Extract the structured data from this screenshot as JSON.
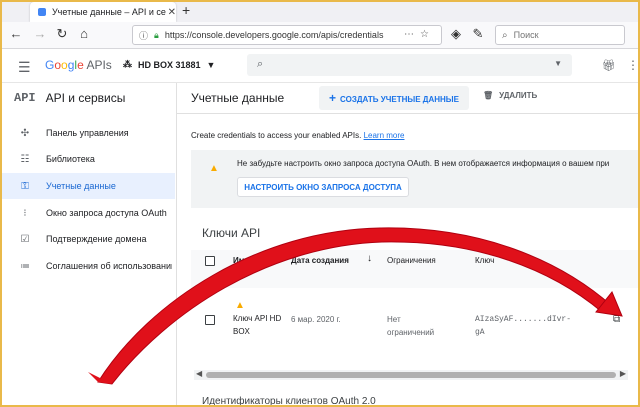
{
  "browser": {
    "tab_title": "Учетные данные – API и сервисы",
    "tab_close": "✕",
    "new_tab": "+",
    "url": "https://console.developers.google.com/apis/credentials",
    "search_placeholder": "Поиск"
  },
  "header": {
    "logo_google": [
      "G",
      "o",
      "o",
      "g",
      "l",
      "e"
    ],
    "logo_apis": "APIs",
    "project": "HD BOX 31881"
  },
  "sidebar": {
    "icon_text": "API",
    "title": "API и сервисы",
    "items": [
      {
        "label": "Панель управления",
        "icon": "dashboard-icon",
        "active": false
      },
      {
        "label": "Библиотека",
        "icon": "library-icon",
        "active": false
      },
      {
        "label": "Учетные данные",
        "icon": "key-icon",
        "active": true
      },
      {
        "label": "Окно запроса доступа OAuth",
        "icon": "consent-icon",
        "active": false
      },
      {
        "label": "Подтверждение домена",
        "icon": "domain-check-icon",
        "active": false
      },
      {
        "label": "Соглашения об использовании страниц",
        "icon": "settings-list-icon",
        "active": false
      }
    ]
  },
  "toolbar": {
    "title": "Учетные данные",
    "create_label": "СОЗДАТЬ УЧЕТНЫЕ ДАННЫЕ",
    "delete_label": "УДАЛИТЬ"
  },
  "intro": {
    "text": "Create credentials to access your enabled APIs.",
    "link": "Learn more"
  },
  "notice": {
    "text": "Не забудьте настроить окно запроса доступа OAuth. В нем отображается информация о вашем при",
    "button": "НАСТРОИТЬ ОКНО ЗАПРОСА ДОСТУПА"
  },
  "api_keys": {
    "title": "Ключи API",
    "columns": [
      "Имя",
      "Дата создания",
      "Ограничения",
      "Ключ"
    ],
    "rows": [
      {
        "name": "Ключ API HD BOX",
        "created": "6 мар. 2020 г.",
        "restrictions": "Нет ограничений",
        "key": "AIzaSyAF.......dIvr-gA"
      }
    ]
  },
  "next_section": "Идентификаторы клиентов OAuth 2.0",
  "colors": {
    "accent": "#1a73e8",
    "warning": "#f9ab00",
    "arrow_red": "#e0101a",
    "frame": "#e9b94a"
  }
}
